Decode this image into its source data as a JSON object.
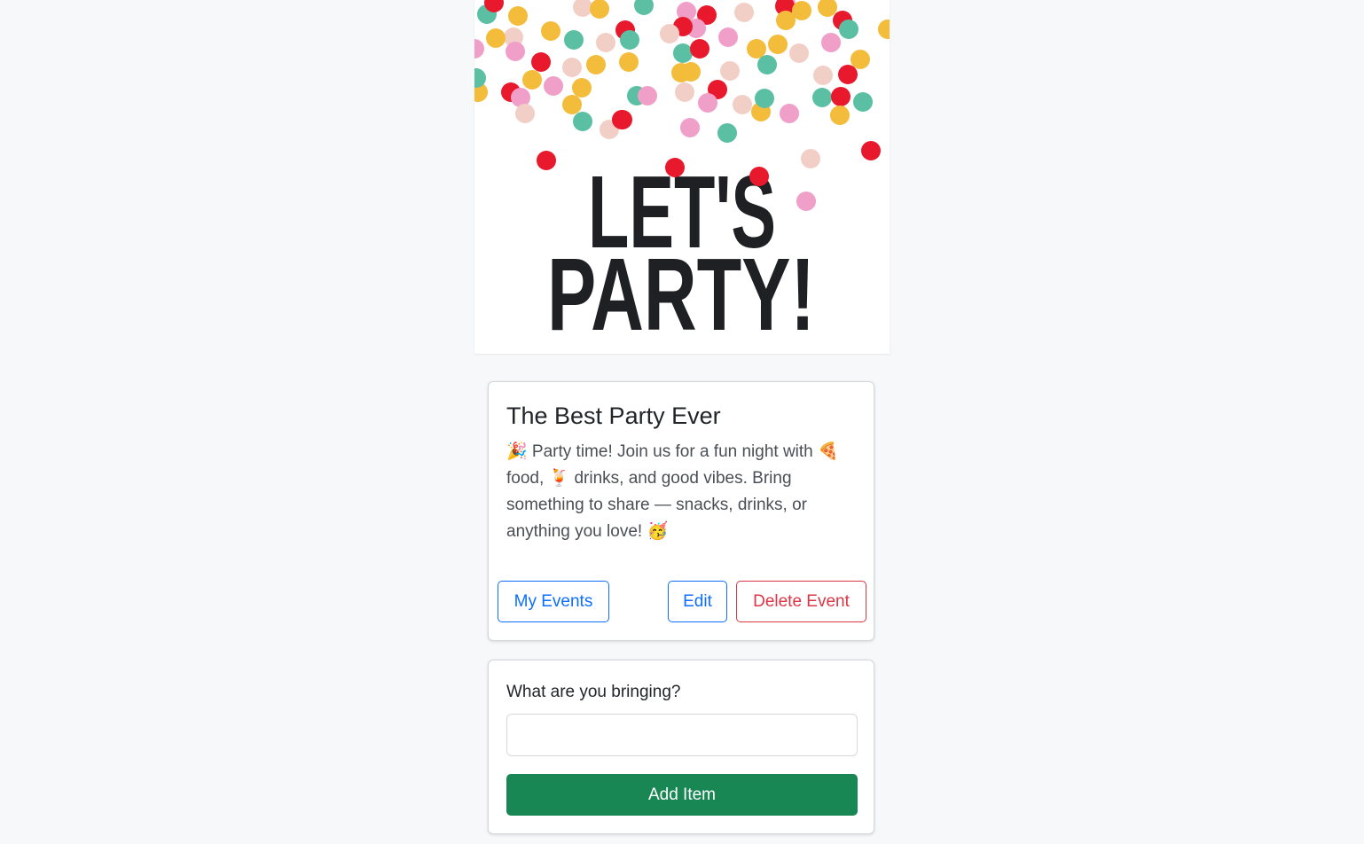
{
  "banner": {
    "line1": "LET'S",
    "line2": "PARTY!",
    "colors": {
      "red": "#e8192c",
      "yellow": "#f4bc3b",
      "teal": "#5bbfa4",
      "pink": "#f09fc8",
      "blush": "#f2cfc6",
      "ink": "#1f2023"
    }
  },
  "event": {
    "title": "The Best Party Ever",
    "description": "🎉 Party time! Join us for a fun night with 🍕 food, 🍹 drinks, and good vibes. Bring something to share — snacks, drinks, or anything you love! 🥳",
    "buttons": {
      "my_events": "My Events",
      "edit": "Edit",
      "delete": "Delete Event"
    }
  },
  "form": {
    "label": "What are you bringing?",
    "input_value": "",
    "submit_label": "Add Item"
  }
}
